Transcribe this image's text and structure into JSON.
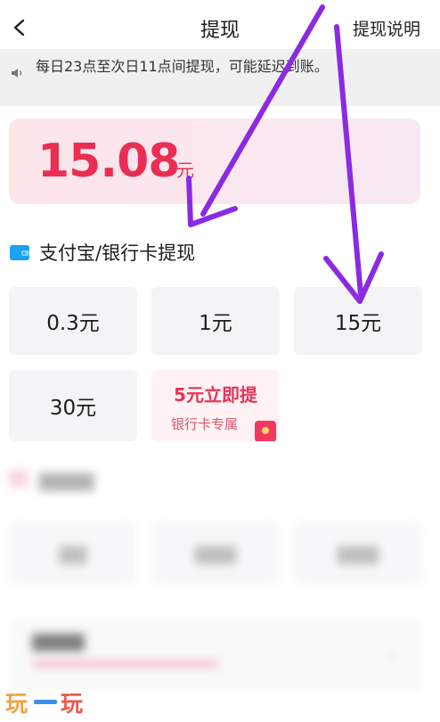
{
  "header": {
    "title": "提现",
    "explain_label": "提现说明"
  },
  "notice": {
    "text": "每日23点至次日11点间提现，可能延迟到账。"
  },
  "balance": {
    "amount": "15.08",
    "unit": "元"
  },
  "section": {
    "label": "支付宝/银行卡提现"
  },
  "amount_options": [
    {
      "label": "0.3元"
    },
    {
      "label": "1元"
    },
    {
      "label": "15元"
    },
    {
      "label": "30元"
    }
  ],
  "promo": {
    "title": "5元立即提",
    "subtitle": "银行卡专属"
  },
  "watermark": {
    "text": "玩一玩"
  },
  "colors": {
    "accent": "#ea2e53",
    "arrow": "#8a2be2"
  },
  "icons": [
    "back-arrow-icon",
    "speaker-icon",
    "wallet-icon",
    "red-envelope-icon"
  ]
}
